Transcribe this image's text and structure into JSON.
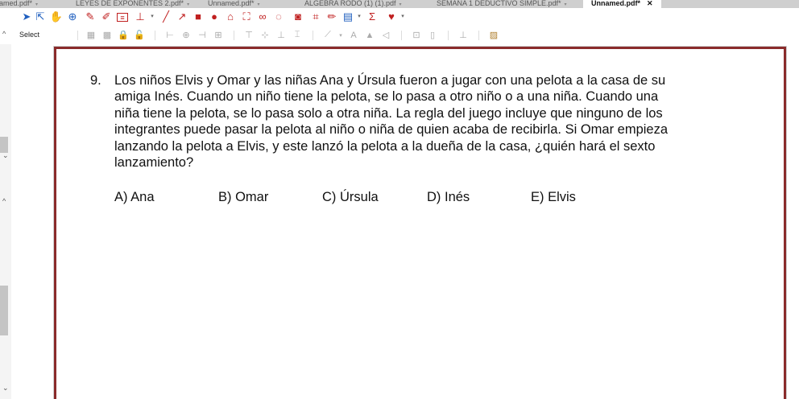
{
  "tabs": [
    {
      "label": "named.pdf*"
    },
    {
      "label": "LEYES DE EXPONENTES 2.pdf*"
    },
    {
      "label": "Unnamed.pdf*"
    },
    {
      "label": "ALGEBRA RODO (1) (1).pdf"
    },
    {
      "label": "SEMANA 1 DEDUCTIVO SIMPLE.pdf*"
    },
    {
      "label": "Unnamed.pdf*",
      "active": true
    }
  ],
  "toolbar": {
    "select_label": "Select",
    "tools": [
      "pointer-icon",
      "select-text-icon",
      "hand-icon",
      "zoom-icon",
      "pencil-icon",
      "marker-icon",
      "textbox-icon",
      "stamp-icon",
      "line-icon",
      "arrow-icon",
      "rectangle-icon",
      "ellipse-icon",
      "polygon-icon",
      "cloud-icon",
      "link-icon",
      "callout-icon",
      "camera-icon",
      "crop-icon",
      "eraser-icon",
      "sticky-note-icon",
      "sum-icon",
      "heart-icon"
    ]
  },
  "question": {
    "number": "9.",
    "text": "Los niños Elvis y Omar y las niñas Ana y Úrsula fueron a jugar con una pelota a la casa de su amiga Inés. Cuando un niño tiene la pelota, se lo pasa a otro niño o a una niña. Cuando una niña tiene la pelota, se lo pasa solo a otra niña. La regla del juego incluye que ninguno de los integrantes puede pasar la pelota al niño o niña de quien acaba de recibirla. Si Omar empieza lanzando la pelota a Elvis, y este lanzó la pelota a la dueña de la casa, ¿quién hará el sexto lanzamiento?"
  },
  "options": [
    {
      "label": "A) Ana"
    },
    {
      "label": "B) Omar"
    },
    {
      "label": "C) Úrsula"
    },
    {
      "label": "D) Inés"
    },
    {
      "label": "E) Elvis"
    }
  ],
  "colors": {
    "page_border": "#8a2b2b",
    "accent_red": "#d42020",
    "tab_bar": "#cfcfcf"
  }
}
